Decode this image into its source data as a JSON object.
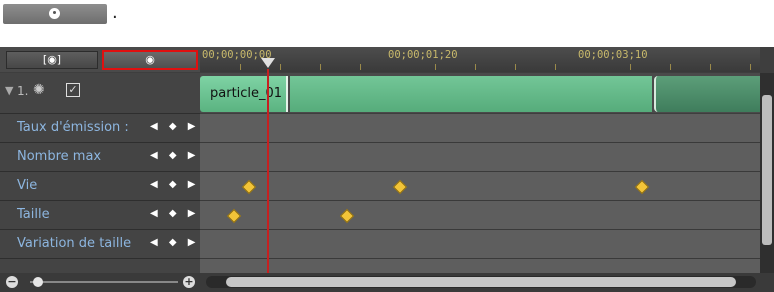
{
  "snippet": {
    "trailing_text": "."
  },
  "header": {
    "left_button_label": "[◉]",
    "right_button_label": "◉"
  },
  "ruler": {
    "timecodes": [
      "00;00;00;00",
      "00;00;01;20",
      "00;00;03;10"
    ]
  },
  "track": {
    "index_label": "1.",
    "clip_label": "particle_01",
    "clip_color": "#6fc393"
  },
  "properties": [
    {
      "label": "Taux d'émission :",
      "nav": "◀ ◆ ▶"
    },
    {
      "label": "Nombre max",
      "nav": "◀ ◆ ▶"
    },
    {
      "label": "Vie",
      "nav": "◀ ◆ ▶"
    },
    {
      "label": "Taille",
      "nav": "◀ ◆ ▶"
    },
    {
      "label": "Variation de taille",
      "nav": "◀ ◆ ▶"
    }
  ],
  "colors": {
    "highlight": "#e01010",
    "playhead": "#c62020",
    "keyframe": "#f2c438",
    "label": "#8db6e0"
  },
  "zoom": {
    "minus": "−",
    "plus": "+"
  }
}
